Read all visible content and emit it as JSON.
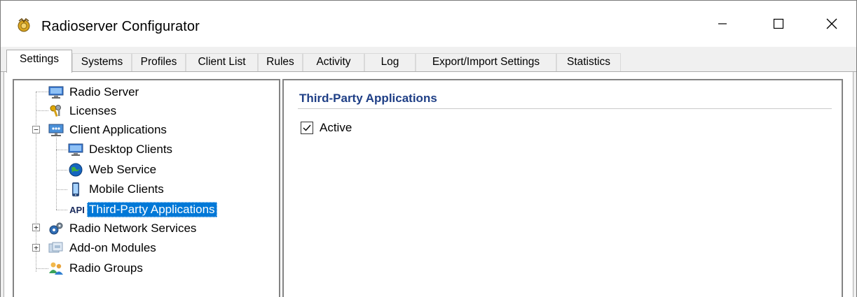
{
  "window": {
    "title": "Radioserver Configurator",
    "controls": {
      "minimize": "minimize-icon",
      "maximize": "maximize-icon",
      "close": "close-icon"
    }
  },
  "tabs": [
    {
      "label": "Settings",
      "active": true
    },
    {
      "label": "Systems",
      "active": false
    },
    {
      "label": "Profiles",
      "active": false
    },
    {
      "label": "Client List",
      "active": false
    },
    {
      "label": "Rules",
      "active": false
    },
    {
      "label": "Activity",
      "active": false
    },
    {
      "label": "Log",
      "active": false
    },
    {
      "label": "Export/Import Settings",
      "active": false
    },
    {
      "label": "Statistics",
      "active": false
    }
  ],
  "tree": {
    "items": [
      {
        "label": "Radio Server",
        "icon": "monitor-icon",
        "level": 0
      },
      {
        "label": "Licenses",
        "icon": "keys-icon",
        "level": 0
      },
      {
        "label": "Client Applications",
        "icon": "network-icon",
        "level": 0,
        "expander": "−"
      },
      {
        "label": "Desktop Clients",
        "icon": "monitor-icon",
        "level": 1
      },
      {
        "label": "Web Service",
        "icon": "globe-icon",
        "level": 1
      },
      {
        "label": "Mobile Clients",
        "icon": "phone-icon",
        "level": 1
      },
      {
        "label": "Third-Party Applications",
        "icon": "api-icon",
        "icon_text": "API",
        "level": 1,
        "selected": true
      },
      {
        "label": "Radio Network Services",
        "icon": "gears-icon",
        "level": 0,
        "expander": "+"
      },
      {
        "label": "Add-on Modules",
        "icon": "modules-icon",
        "level": 0,
        "expander": "+"
      },
      {
        "label": "Radio Groups",
        "icon": "group-icon",
        "level": 0
      }
    ]
  },
  "details": {
    "section_title": "Third-Party Applications",
    "active_checkbox": {
      "label": "Active",
      "checked": true
    }
  },
  "colors": {
    "selection": "#0078d7",
    "section_title": "#1f3f86"
  }
}
